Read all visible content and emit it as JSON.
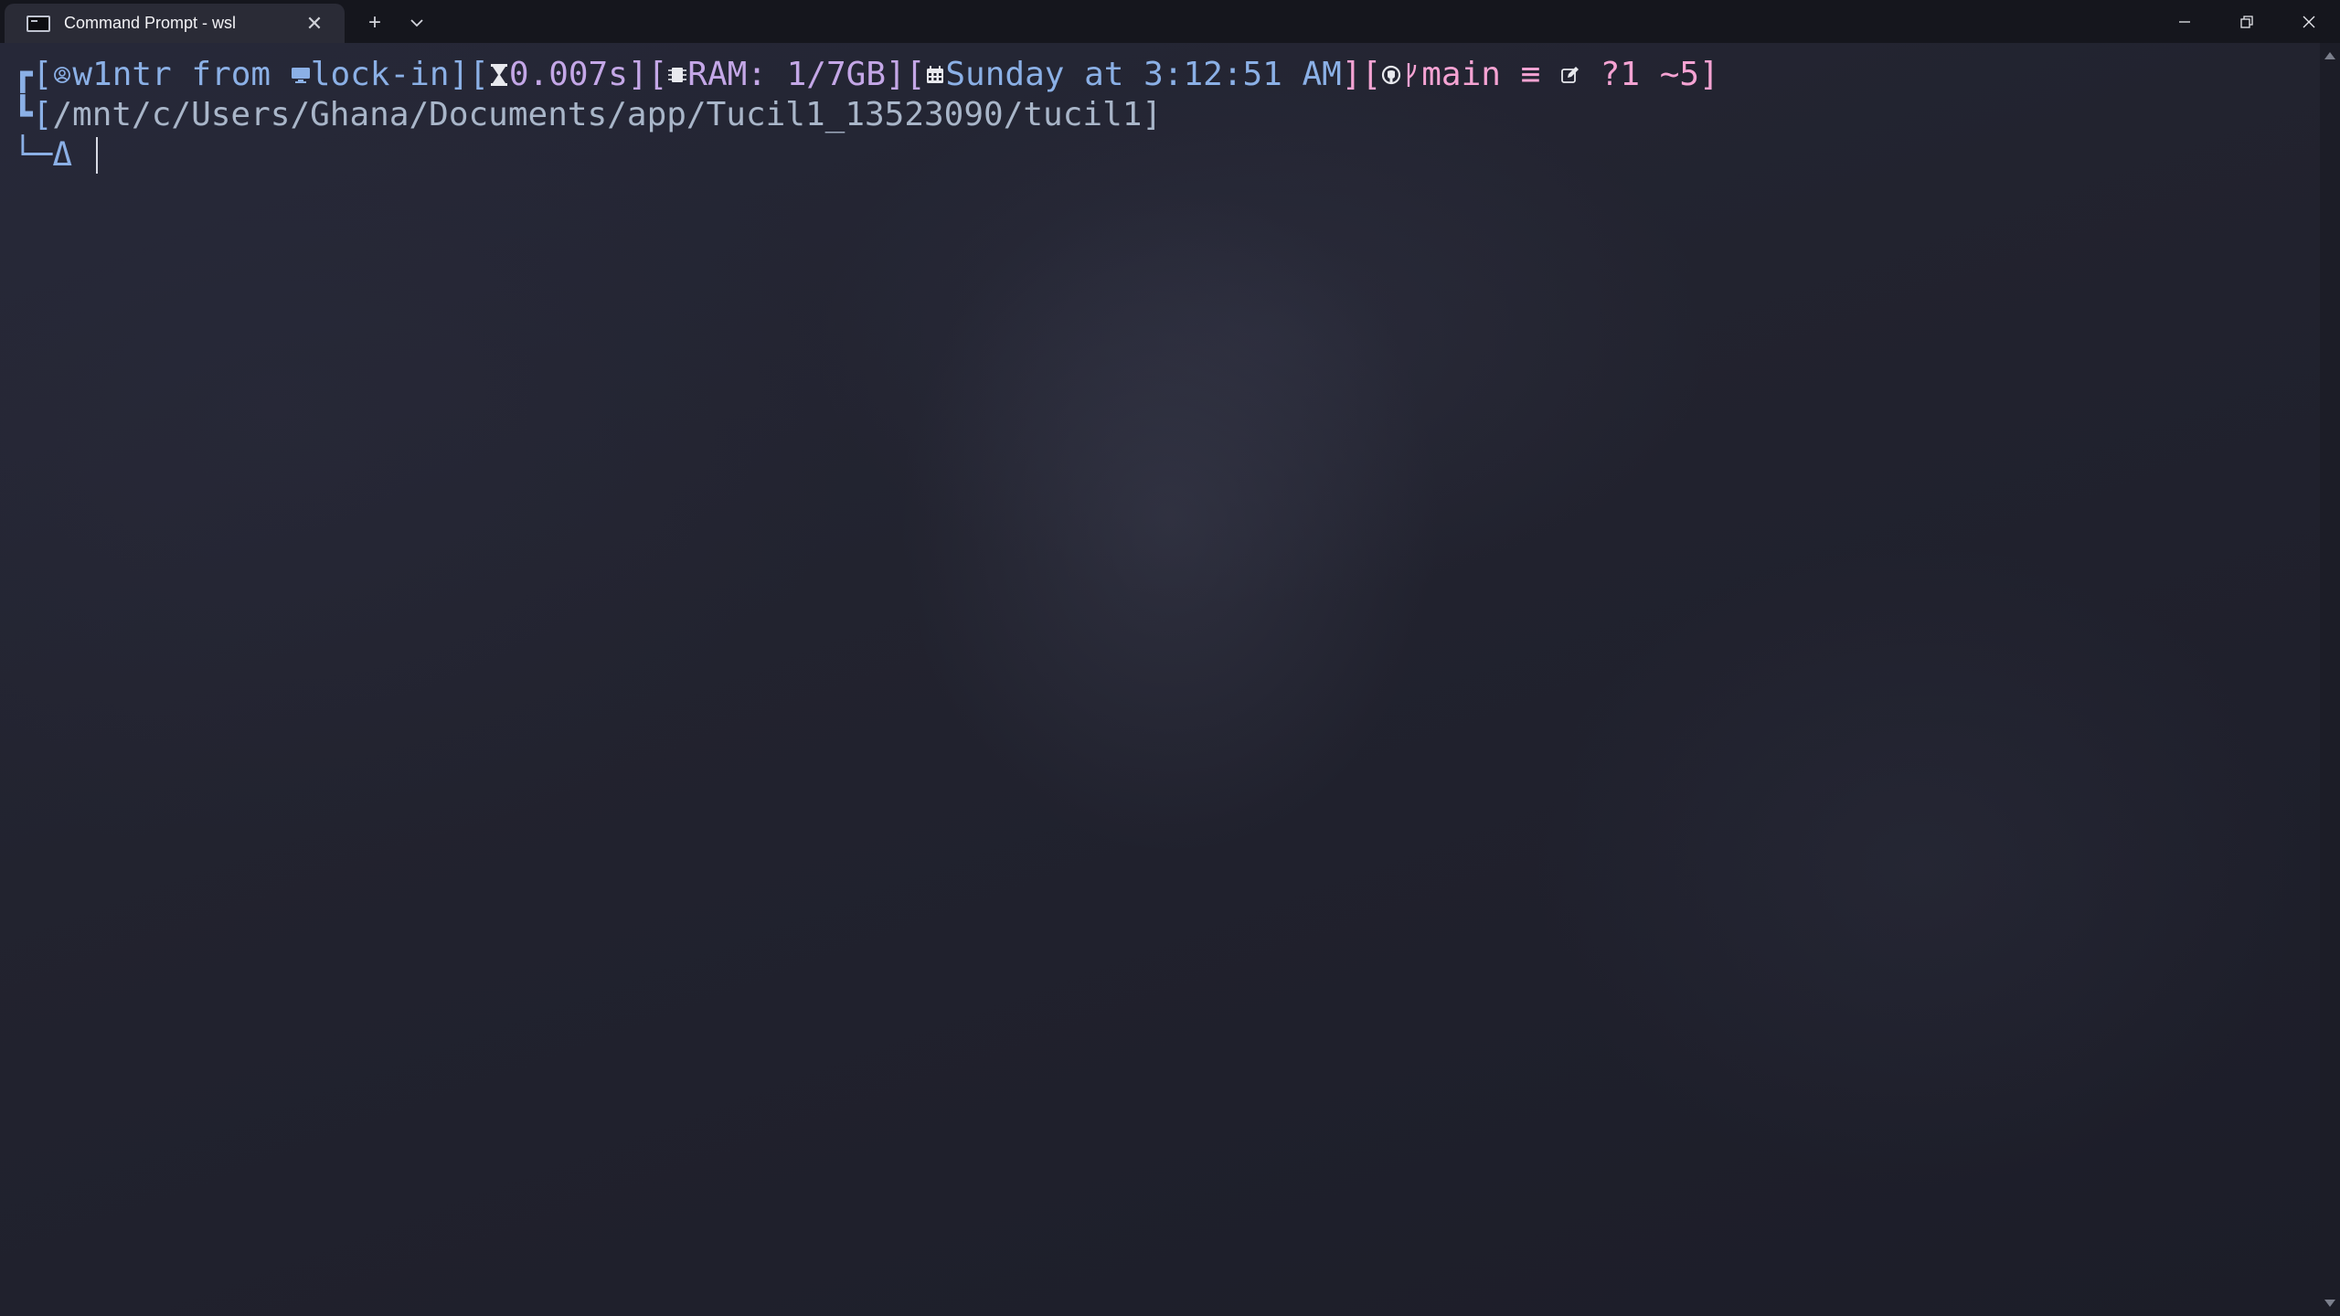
{
  "window": {
    "tab_title": "Command Prompt - wsl",
    "tab_close_glyph": "✕",
    "new_tab_glyph": "+",
    "dropdown_glyph": "⌄"
  },
  "prompt": {
    "line1": {
      "frame_open": "┏[",
      "user": "w1ntr",
      "from": " from ",
      "host": "lock-in",
      "sep1": "][",
      "duration": "0.007s",
      "sep2": "][",
      "ram": "RAM: 1/7GB",
      "sep3": "][",
      "date": "Sunday at 3:12:51 AM",
      "sep4": "][",
      "branch": "main",
      "git_status": "≡",
      "git_changes": "?1 ~5",
      "close": "]"
    },
    "line2": {
      "frame": "┗[",
      "path": "/mnt/c/Users/Ghana/Documents/app/Tucil1_13523090/tucil1",
      "close": "]"
    },
    "line3": {
      "arrow": "└─Δ"
    }
  },
  "colors": {
    "frame": "#8bb0e6",
    "time": "#c4a7e7",
    "git": "#f5a3d3",
    "path": "#a9b6c9",
    "background": "#1b1c28"
  },
  "icons": [
    "user-circle-icon",
    "monitor-icon",
    "hourglass-icon",
    "memory-chip-icon",
    "calendar-icon",
    "github-icon",
    "git-branch-icon",
    "edit-icon"
  ]
}
